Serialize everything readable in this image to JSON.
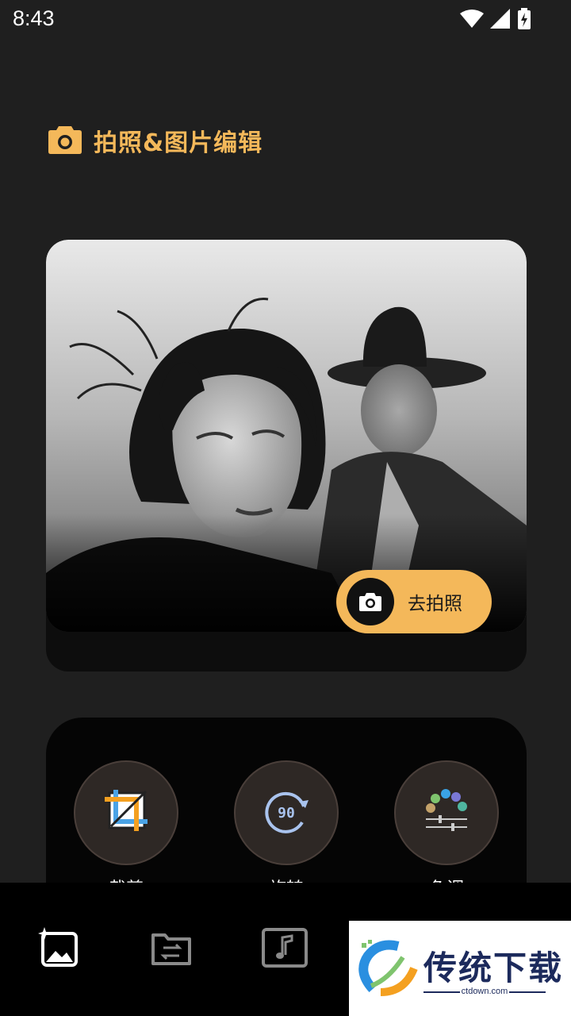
{
  "status_bar": {
    "time": "8:43",
    "icons": [
      "wifi-icon",
      "signal-icon",
      "battery-charging-icon"
    ]
  },
  "header": {
    "icon": "camera-icon",
    "title": "拍照&图片编辑"
  },
  "photo_card": {
    "image": "black-and-white portrait photo",
    "shoot_button_label": "去拍照",
    "shoot_button_icon": "camera-icon"
  },
  "tools": [
    {
      "label": "裁剪",
      "icon": "crop-icon"
    },
    {
      "label": "旋转",
      "icon": "rotate-90-icon"
    },
    {
      "label": "色调",
      "icon": "color-adjust-icon"
    }
  ],
  "bottom_nav": {
    "items": [
      "image-edit-icon",
      "file-convert-icon",
      "music-icon"
    ]
  },
  "watermark": {
    "name": "传统下载",
    "url": "ctdown.com"
  },
  "colors": {
    "accent": "#f4b85a",
    "background": "#1f1f1f",
    "card": "#050505",
    "tool_circle": "#2e2825"
  }
}
